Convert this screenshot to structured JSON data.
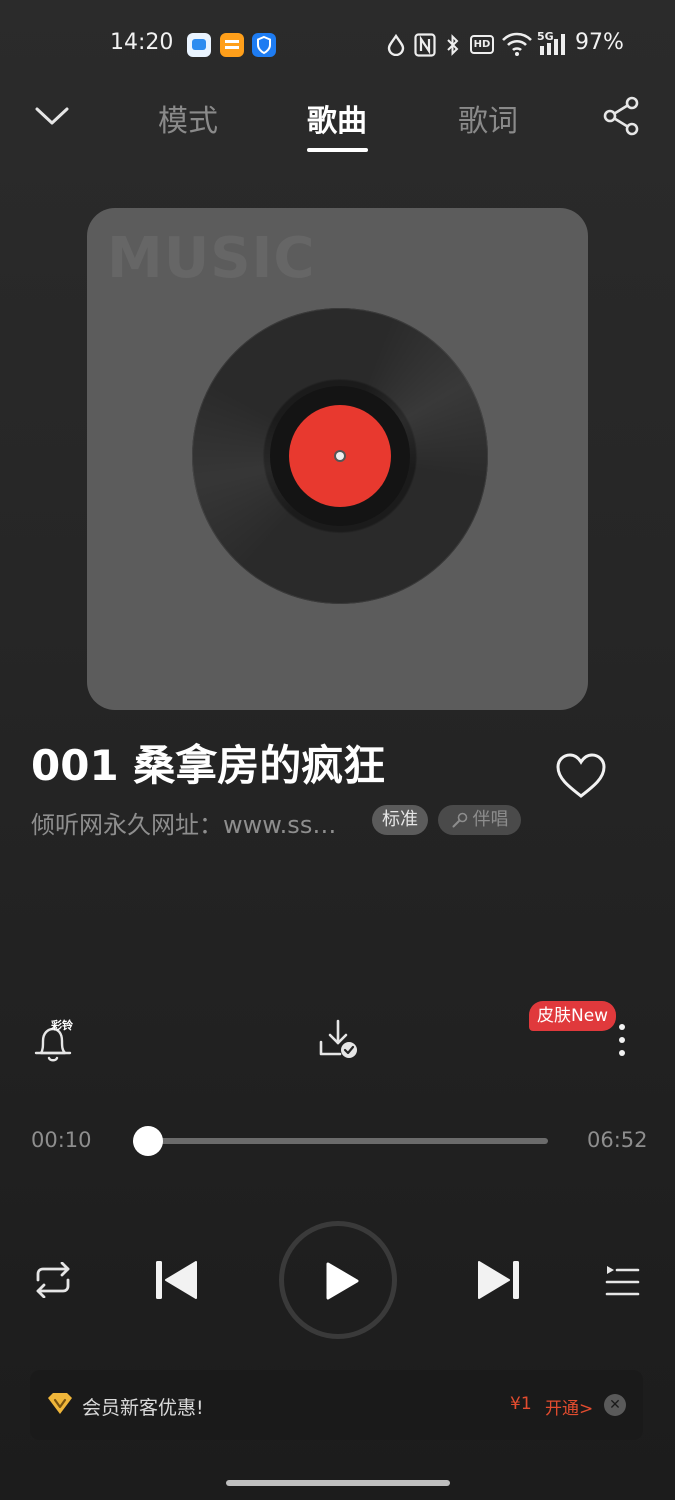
{
  "status_bar": {
    "time": "14:20",
    "network": "5G",
    "hd_badge": "HD",
    "battery": "97%",
    "icons": [
      "app-blue-icon",
      "app-orange-icon",
      "app-shield-icon",
      "drop-icon",
      "nfc-icon",
      "bluetooth-icon",
      "wifi-icon",
      "signal-icon"
    ]
  },
  "header": {
    "tabs": [
      {
        "label": "模式",
        "active": false
      },
      {
        "label": "歌曲",
        "active": true
      },
      {
        "label": "歌词",
        "active": false
      }
    ]
  },
  "album": {
    "watermark": "MUSIC",
    "label_color": "#e8392f"
  },
  "song": {
    "title": "001 桑拿房的疯狂",
    "subtitle": "倾听网永久网址：www.ss…",
    "quality_tag": "标准",
    "karaoke_tag": "伴唱"
  },
  "actions": {
    "ringtone_label": "彩铃",
    "skin_badge": "皮肤New"
  },
  "progress": {
    "current": "00:10",
    "total": "06:52",
    "fraction": 0.02
  },
  "promo": {
    "text": "会员新客优惠!",
    "price": "¥1",
    "action": "开通>"
  },
  "colors": {
    "accent_red": "#e0393c",
    "promo_orange": "#e34c2f",
    "gold": "#f0b63a"
  }
}
